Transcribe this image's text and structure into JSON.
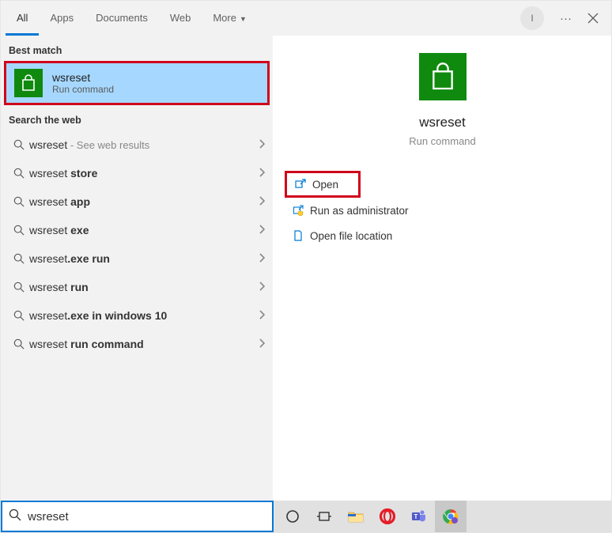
{
  "tabs": {
    "all": "All",
    "apps": "Apps",
    "documents": "Documents",
    "web": "Web",
    "more": "More"
  },
  "avatar_letter": "I",
  "sections": {
    "best_match": "Best match",
    "search_web": "Search the web"
  },
  "best_match": {
    "title": "wsreset",
    "subtitle": "Run command"
  },
  "web_items": [
    {
      "prefix": "wsreset",
      "suffix": "",
      "tail": " - See web results"
    },
    {
      "prefix": "wsreset ",
      "suffix": "store",
      "tail": ""
    },
    {
      "prefix": "wsreset ",
      "suffix": "app",
      "tail": ""
    },
    {
      "prefix": "wsreset ",
      "suffix": "exe",
      "tail": ""
    },
    {
      "prefix": "wsreset",
      "suffix": ".exe run",
      "tail": ""
    },
    {
      "prefix": "wsreset ",
      "suffix": "run",
      "tail": ""
    },
    {
      "prefix": "wsreset",
      "suffix": ".exe in windows 10",
      "tail": ""
    },
    {
      "prefix": "wsreset ",
      "suffix": "run command",
      "tail": ""
    }
  ],
  "preview": {
    "title": "wsreset",
    "subtitle": "Run command"
  },
  "actions": {
    "open": "Open",
    "run_admin": "Run as administrator",
    "open_location": "Open file location"
  },
  "search_input": "wsreset",
  "colors": {
    "accent": "#0078d4",
    "highlight": "#d0021b",
    "store_green": "#0f8a0f"
  }
}
